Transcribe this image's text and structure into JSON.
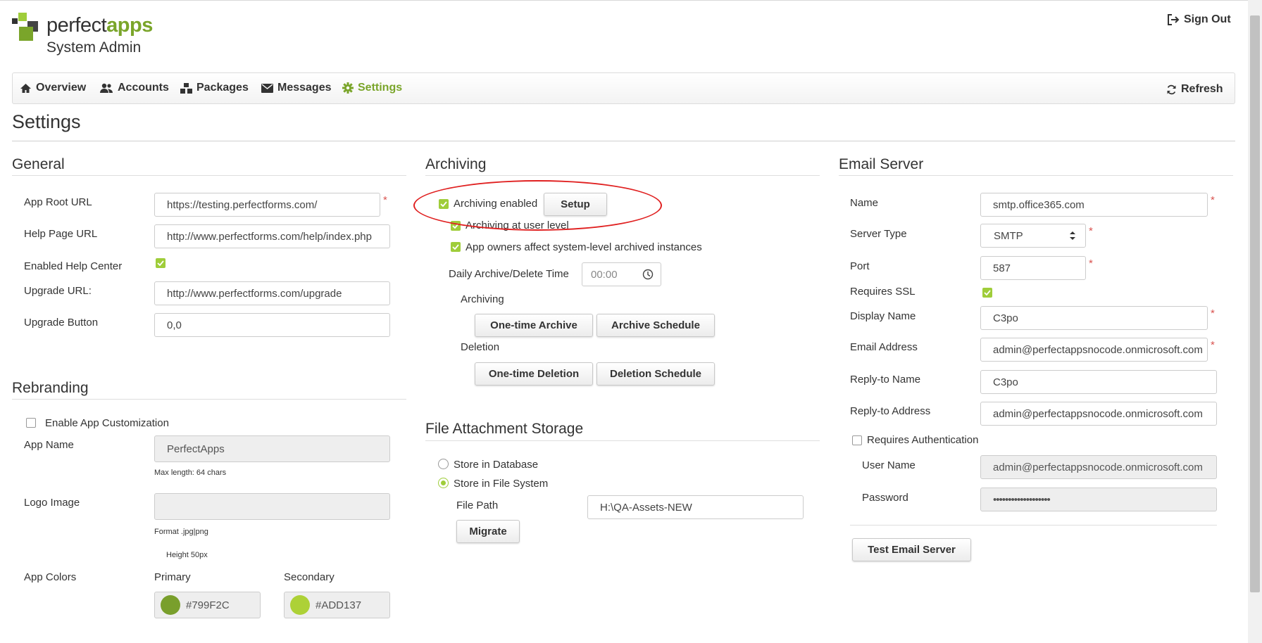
{
  "header": {
    "logo_word1": "perfect",
    "logo_word2": "apps",
    "subtitle": "System Admin",
    "signout_label": "Sign Out"
  },
  "nav": {
    "items": [
      {
        "label": "Overview",
        "icon": "home-icon"
      },
      {
        "label": "Accounts",
        "icon": "users-icon"
      },
      {
        "label": "Packages",
        "icon": "packages-icon"
      },
      {
        "label": "Messages",
        "icon": "envelope-icon"
      },
      {
        "label": "Settings",
        "icon": "gear-icon",
        "active": true
      }
    ],
    "refresh_label": "Refresh"
  },
  "page_title": "Settings",
  "general": {
    "heading": "General",
    "app_root_url_label": "App Root URL",
    "app_root_url_value": "https://testing.perfectforms.com/",
    "help_page_url_label": "Help Page URL",
    "help_page_url_value": "http://www.perfectforms.com/help/index.php",
    "enabled_help_center_label": "Enabled Help Center",
    "enabled_help_center_checked": true,
    "upgrade_url_label": "Upgrade URL:",
    "upgrade_url_value": "http://www.perfectforms.com/upgrade",
    "upgrade_button_label": "Upgrade Button",
    "upgrade_button_value": "0,0"
  },
  "rebranding": {
    "heading": "Rebranding",
    "enable_customization_label": "Enable App Customization",
    "enable_customization_checked": false,
    "app_name_label": "App Name",
    "app_name_value": "PerfectApps",
    "max_length_hint": "Max length: 64 chars",
    "logo_image_label": "Logo Image",
    "format_hint": "Format .jpg|png",
    "height_hint": "Height 50px",
    "app_colors_label": "App Colors",
    "primary_label": "Primary",
    "primary_value": "#799F2C",
    "secondary_label": "Secondary",
    "secondary_value": "#ADD137"
  },
  "archiving": {
    "heading": "Archiving",
    "archiving_enabled_label": "Archiving enabled",
    "setup_button": "Setup",
    "archiving_user_level_label": "Archiving at user level",
    "app_owners_label": "App owners affect system-level archived instances",
    "daily_time_label": "Daily Archive/Delete Time",
    "daily_time_value": "00:00",
    "archiving_sub_label": "Archiving",
    "one_time_archive": "One-time Archive",
    "archive_schedule": "Archive Schedule",
    "deletion_sub_label": "Deletion",
    "one_time_deletion": "One-time Deletion",
    "deletion_schedule": "Deletion Schedule"
  },
  "file_storage": {
    "heading": "File Attachment Storage",
    "store_db_label": "Store in Database",
    "store_fs_label": "Store in File System",
    "file_path_label": "File Path",
    "file_path_value": "H:\\QA-Assets-NEW",
    "migrate_button": "Migrate"
  },
  "email_server": {
    "heading": "Email Server",
    "name_label": "Name",
    "name_value": "smtp.office365.com",
    "server_type_label": "Server Type",
    "server_type_value": "SMTP",
    "port_label": "Port",
    "port_value": "587",
    "requires_ssl_label": "Requires SSL",
    "display_name_label": "Display Name",
    "display_name_value": "C3po",
    "email_address_label": "Email Address",
    "email_address_value": "admin@perfectappsnocode.onmicrosoft.com",
    "reply_to_name_label": "Reply-to Name",
    "reply_to_name_value": "C3po",
    "reply_to_address_label": "Reply-to Address",
    "reply_to_address_value": "admin@perfectappsnocode.onmicrosoft.com",
    "requires_auth_label": "Requires Authentication",
    "user_name_label": "User Name",
    "user_name_value": "admin@perfectappsnocode.onmicrosoft.com",
    "password_label": "Password",
    "password_value": "•••••••••••••••••••",
    "test_button": "Test Email Server"
  }
}
